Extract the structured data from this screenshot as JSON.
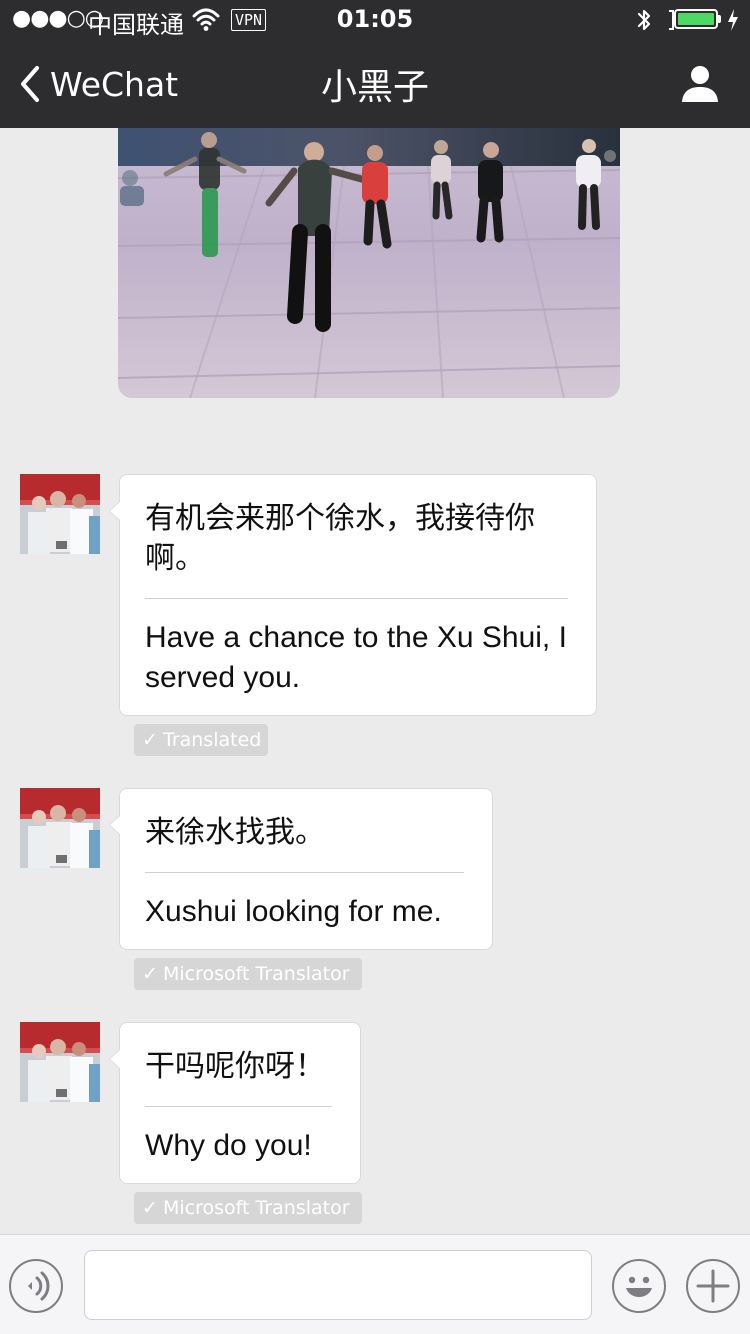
{
  "status_bar": {
    "signal": "●●●○○",
    "carrier": "中国联通",
    "vpn": "VPN",
    "time": "01:05",
    "battery_level": 1.0,
    "icons": [
      "wifi-icon",
      "bluetooth-icon",
      "charging-icon",
      "battery-icon"
    ]
  },
  "nav": {
    "back_label": "WeChat",
    "title": "小黑子",
    "icons": [
      "chevron-left-icon",
      "profile-icon"
    ]
  },
  "messages": [
    {
      "original": "有机会来那个徐水，我接待你啊。",
      "translation": "Have a chance to the Xu Shui, I served you.",
      "badge": "Translated",
      "check": "✓"
    },
    {
      "original": "来徐水找我。",
      "translation": "Xushui looking for me.",
      "badge": "Microsoft Translator",
      "check": "✓"
    },
    {
      "original": "干吗呢你呀！",
      "translation": "Why do you!",
      "badge": "Microsoft Translator",
      "check": "✓"
    }
  ],
  "input_bar": {
    "placeholder": "",
    "icons": [
      "voice-icon",
      "emoji-icon",
      "plus-icon"
    ]
  },
  "colors": {
    "navbar": "#2d2d2f",
    "chat_background": "#ebebeb",
    "bubble": "#ffffff",
    "badge": "#d6d6d6",
    "battery": "#4cd964"
  }
}
